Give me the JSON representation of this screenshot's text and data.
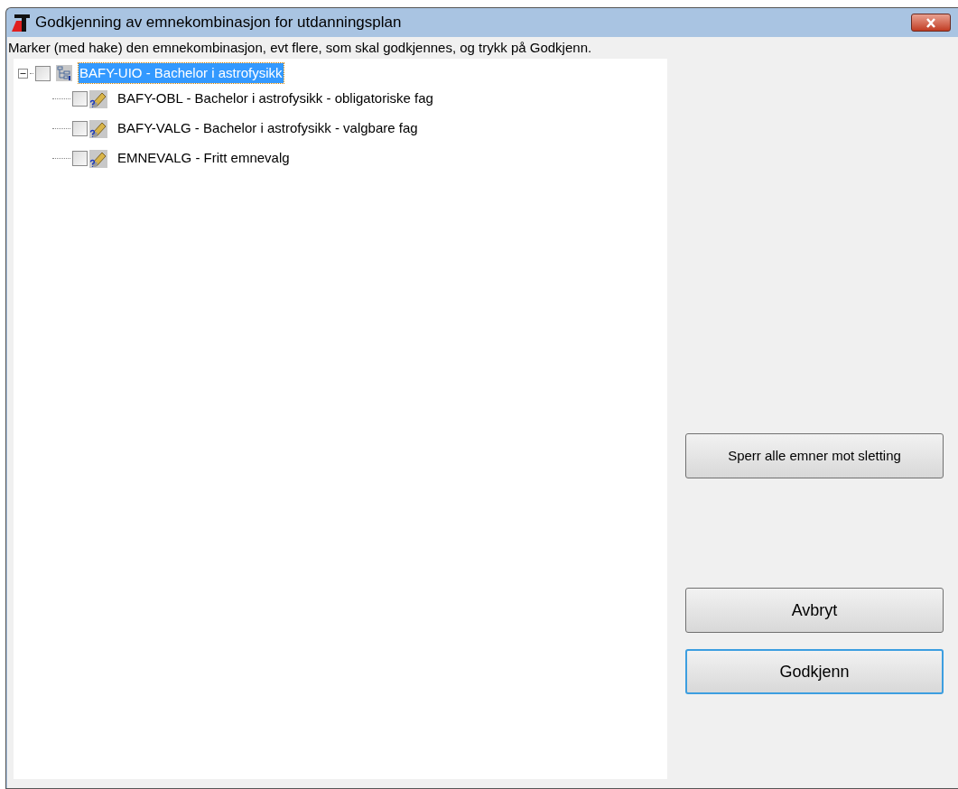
{
  "window": {
    "title": "Godkjenning av emnekombinasjon for utdanningsplan"
  },
  "instruction": "Marker (med hake) den emnekombinasjon, evt flere, som skal godkjennes, og trykk på Godkjenn.",
  "tree": [
    {
      "label": "BAFY-UIO - Bachelor i astrofysikk",
      "kind": "plan",
      "checked": false,
      "selected": true,
      "expanded": true,
      "children": [
        {
          "label": "BAFY-OBL - Bachelor i astrofysikk - obligatoriske fag",
          "kind": "combination",
          "checked": false,
          "selected": false
        },
        {
          "label": "BAFY-VALG - Bachelor i astrofysikk - valgbare fag",
          "kind": "combination",
          "checked": false,
          "selected": false
        },
        {
          "label": "EMNEVALG - Fritt emnevalg",
          "kind": "combination",
          "checked": false,
          "selected": false
        }
      ]
    }
  ],
  "lock_button": "Sperr alle emner mot sletting",
  "buttons": [
    {
      "label": "Avbryt",
      "focused": false
    },
    {
      "label": "Godkjenn",
      "focused": true
    }
  ]
}
